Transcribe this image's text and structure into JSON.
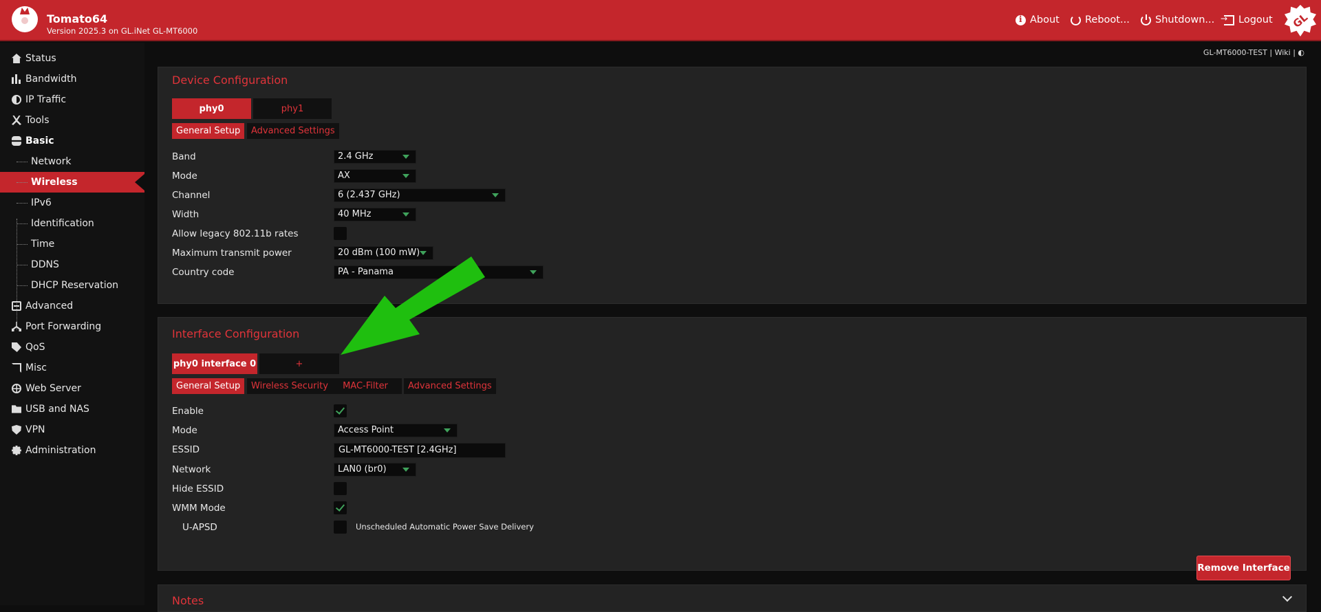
{
  "header": {
    "title": "Tomato64",
    "version": "Version 2025.3 on GL.iNet GL-MT6000",
    "nav": {
      "about": "About",
      "reboot": "Reboot...",
      "shutdown": "Shutdown...",
      "logout": "Logout"
    },
    "icons": [
      "info-icon",
      "reboot-icon",
      "power-icon",
      "logout-icon"
    ]
  },
  "sidebar": {
    "items": [
      {
        "label": "Status",
        "icon": "home-icon"
      },
      {
        "label": "Bandwidth",
        "icon": "bar-chart-icon"
      },
      {
        "label": "IP Traffic",
        "icon": "pie-icon"
      },
      {
        "label": "Tools",
        "icon": "tools-icon"
      },
      {
        "label": "Basic",
        "icon": "database-icon"
      },
      {
        "label": "Advanced",
        "icon": "box-icon"
      },
      {
        "label": "Port Forwarding",
        "icon": "fork-icon"
      },
      {
        "label": "QoS",
        "icon": "tag-icon"
      },
      {
        "label": "Misc",
        "icon": "cast-icon"
      },
      {
        "label": "Web Server",
        "icon": "globe-icon"
      },
      {
        "label": "USB and NAS",
        "icon": "folder-icon"
      },
      {
        "label": "VPN",
        "icon": "shield-icon"
      },
      {
        "label": "Administration",
        "icon": "gear-icon"
      }
    ],
    "basic_sub": [
      "Network",
      "Wireless",
      "IPv6",
      "Identification",
      "Time",
      "DDNS",
      "DHCP Reservation"
    ],
    "active": "Wireless"
  },
  "crumb": "GL-MT6000-TEST | Wiki | ◐",
  "device": {
    "title": "Device Configuration",
    "tabs": [
      "phy0",
      "phy1"
    ],
    "subtabs": [
      "General Setup",
      "Advanced Settings"
    ],
    "fields": {
      "band": {
        "label": "Band",
        "value": "2.4 GHz"
      },
      "mode": {
        "label": "Mode",
        "value": "AX"
      },
      "channel": {
        "label": "Channel",
        "value": "6 (2.437 GHz)"
      },
      "width": {
        "label": "Width",
        "value": "40 MHz"
      },
      "legacy": {
        "label": "Allow legacy 802.11b rates",
        "checked": false
      },
      "power": {
        "label": "Maximum transmit power",
        "value": "20 dBm (100 mW)"
      },
      "country": {
        "label": "Country code",
        "value": "PA - Panama"
      }
    }
  },
  "iface": {
    "title": "Interface Configuration",
    "tabs": [
      "phy0 interface 0",
      "+"
    ],
    "subtabs": [
      "General Setup",
      "Wireless Security",
      "MAC-Filter",
      "Advanced Settings"
    ],
    "fields": {
      "enable": {
        "label": "Enable",
        "checked": true
      },
      "mode": {
        "label": "Mode",
        "value": "Access Point"
      },
      "essid": {
        "label": "ESSID",
        "value": "GL-MT6000-TEST [2.4GHz]"
      },
      "network": {
        "label": "Network",
        "value": "LAN0 (br0)"
      },
      "hide": {
        "label": "Hide ESSID",
        "checked": false
      },
      "wmm": {
        "label": "WMM Mode",
        "checked": true
      },
      "uapsd": {
        "label": "U-APSD",
        "checked": false,
        "hint": "Unscheduled Automatic Power Save Delivery"
      }
    },
    "remove": "Remove Interface"
  },
  "notes": {
    "title": "Notes"
  },
  "colors": {
    "accent": "#c4262c",
    "check": "#3fa25b",
    "annotation": "#1fbf0f"
  }
}
